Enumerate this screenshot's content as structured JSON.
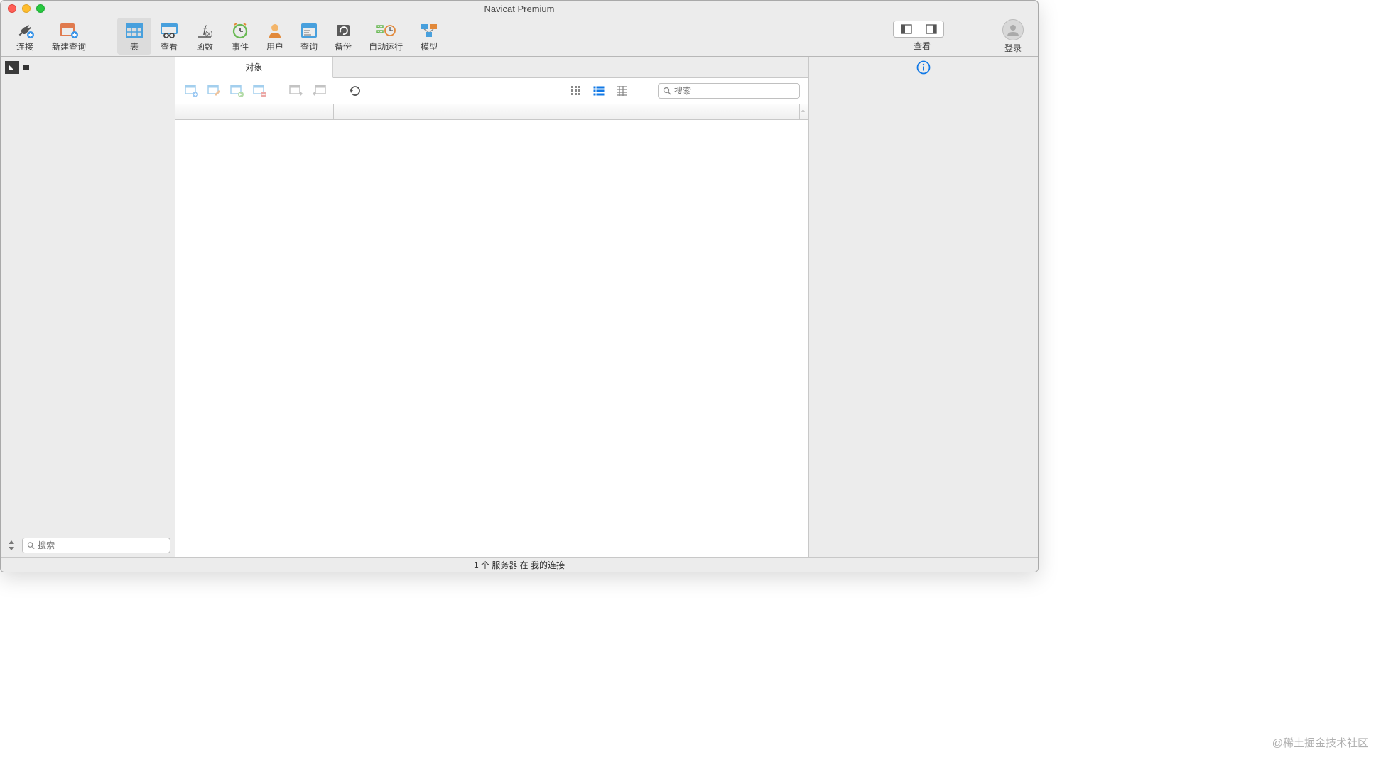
{
  "window": {
    "title": "Navicat Premium"
  },
  "toolbar": {
    "items": [
      {
        "label": "连接"
      },
      {
        "label": "新建查询"
      },
      {
        "label": "表"
      },
      {
        "label": "查看"
      },
      {
        "label": "函数"
      },
      {
        "label": "事件"
      },
      {
        "label": "用户"
      },
      {
        "label": "查询"
      },
      {
        "label": "备份"
      },
      {
        "label": "自动运行"
      },
      {
        "label": "模型"
      }
    ],
    "view_label": "查看",
    "login_label": "登录"
  },
  "tabs": {
    "object_tab": "对象"
  },
  "search": {
    "placeholder": "搜索"
  },
  "sidebar_search": {
    "placeholder": "搜索"
  },
  "status": {
    "text": "1 个 服务器 在 我的连接"
  },
  "watermark": "@稀土掘金技术社区"
}
